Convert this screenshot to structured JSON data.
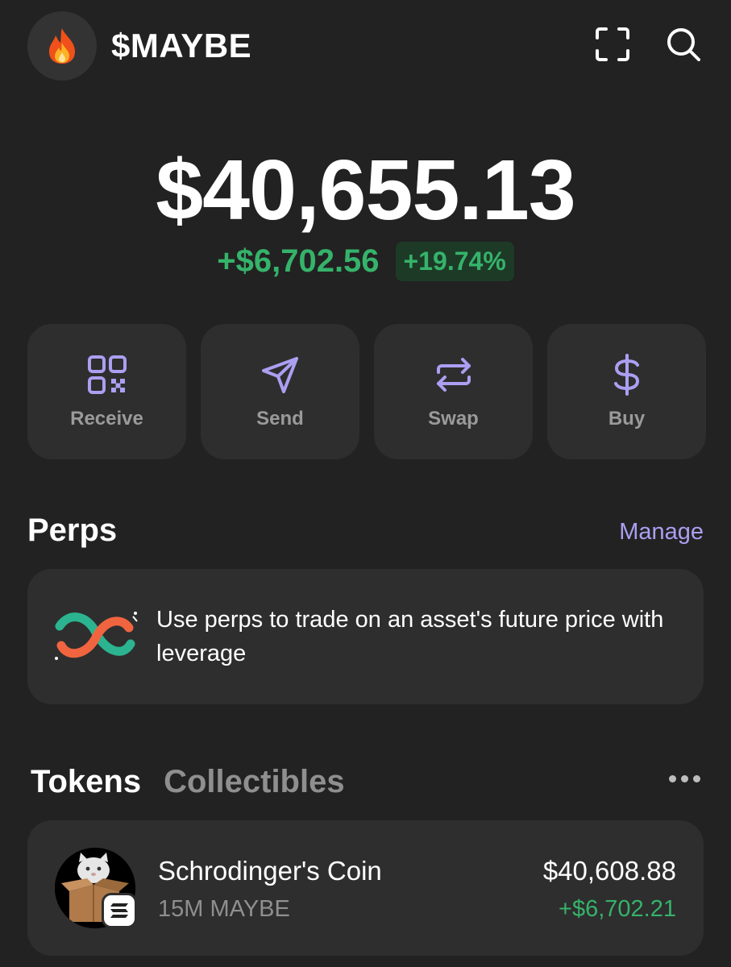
{
  "header": {
    "account_name": "$MAYBE",
    "avatar_icon": "fire-icon",
    "scan_icon": "scan-icon",
    "search_icon": "search-icon"
  },
  "balance": {
    "total": "$40,655.13",
    "change_abs": "+$6,702.56",
    "change_pct": "+19.74%"
  },
  "actions": [
    {
      "label": "Receive",
      "icon": "qr-code-icon"
    },
    {
      "label": "Send",
      "icon": "send-icon"
    },
    {
      "label": "Swap",
      "icon": "swap-icon"
    },
    {
      "label": "Buy",
      "icon": "dollar-icon"
    }
  ],
  "perps": {
    "title": "Perps",
    "manage_label": "Manage",
    "description": "Use perps to trade on an asset's future price with leverage"
  },
  "tabs": [
    {
      "label": "Tokens",
      "active": true
    },
    {
      "label": "Collectibles",
      "active": false
    }
  ],
  "tokens": [
    {
      "name": "Schrodinger's Coin",
      "amount": "15M MAYBE",
      "value": "$40,608.88",
      "change": "+$6,702.21"
    }
  ],
  "colors": {
    "background": "#222222",
    "card": "#2e2e2e",
    "accent": "#ab9ff2",
    "positive": "#35b36a"
  }
}
